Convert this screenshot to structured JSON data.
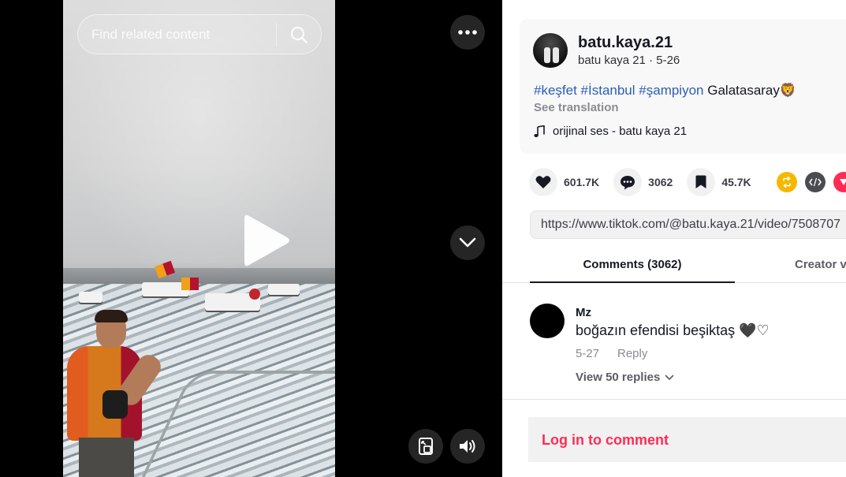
{
  "video": {
    "search_placeholder": "Find related content",
    "controls": {
      "more_icon": "more-horizontal-icon",
      "next_icon": "chevron-down-icon",
      "mini_player_icon": "mini-player-icon",
      "sound_icon": "volume-icon",
      "play_icon": "play-icon"
    }
  },
  "post": {
    "username": "batu.kaya.21",
    "display_name": "batu kaya 21",
    "separator": " · ",
    "date": "5-26",
    "hashtags": [
      "#keşfet",
      "#İstanbul",
      "#şampiyon"
    ],
    "caption_text": "Galatasaray",
    "caption_emoji": "🦁",
    "see_translation": "See translation",
    "sound": "orijinal ses - batu kaya 21"
  },
  "actions": {
    "likes": "601.7K",
    "comments": "3062",
    "saves": "45.7K"
  },
  "share_colors": {
    "repost": "#f5b800",
    "embed": "#4b4c52",
    "other": "#fe2c55"
  },
  "link": "https://www.tiktok.com/@batu.kaya.21/video/7508707",
  "tabs": {
    "comments": "Comments (3062)",
    "creator": "Creator v"
  },
  "comment": {
    "user": "Mz",
    "text": "boğazın efendisi beşiktaş 🖤♡",
    "date": "5-27",
    "reply": "Reply",
    "view_replies": "View 50 replies"
  },
  "login": {
    "label": "Log in to comment"
  },
  "colors": {
    "accent": "#fe2c55",
    "hashtag": "#2b5db9"
  }
}
